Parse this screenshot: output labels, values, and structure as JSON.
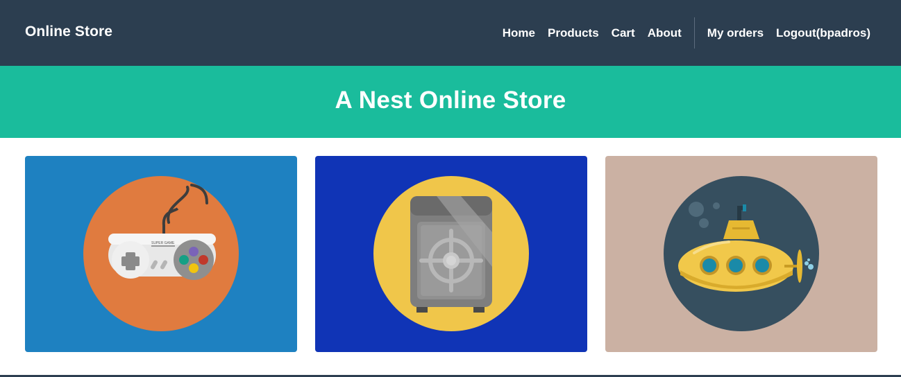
{
  "navbar": {
    "brand": "Online Store",
    "links": [
      {
        "label": "Home"
      },
      {
        "label": "Products"
      },
      {
        "label": "Cart"
      },
      {
        "label": "About"
      }
    ],
    "user_links": [
      {
        "label": "My orders"
      },
      {
        "label": "Logout(bpadros)"
      }
    ]
  },
  "masthead": {
    "title": "A Nest Online Store"
  },
  "products": [
    {
      "icon": "game-controller-icon",
      "background": "#1e81c1",
      "circle": "#e07b3f"
    },
    {
      "icon": "safe-icon",
      "background": "#1034b6",
      "circle": "#f0c64a"
    },
    {
      "icon": "submarine-icon",
      "background": "#cbb1a3",
      "circle": "#364f5f"
    }
  ],
  "controller_text": "SUPER GAME",
  "colors": {
    "navbar": "#2c3e50",
    "accent": "#1abc9c"
  }
}
